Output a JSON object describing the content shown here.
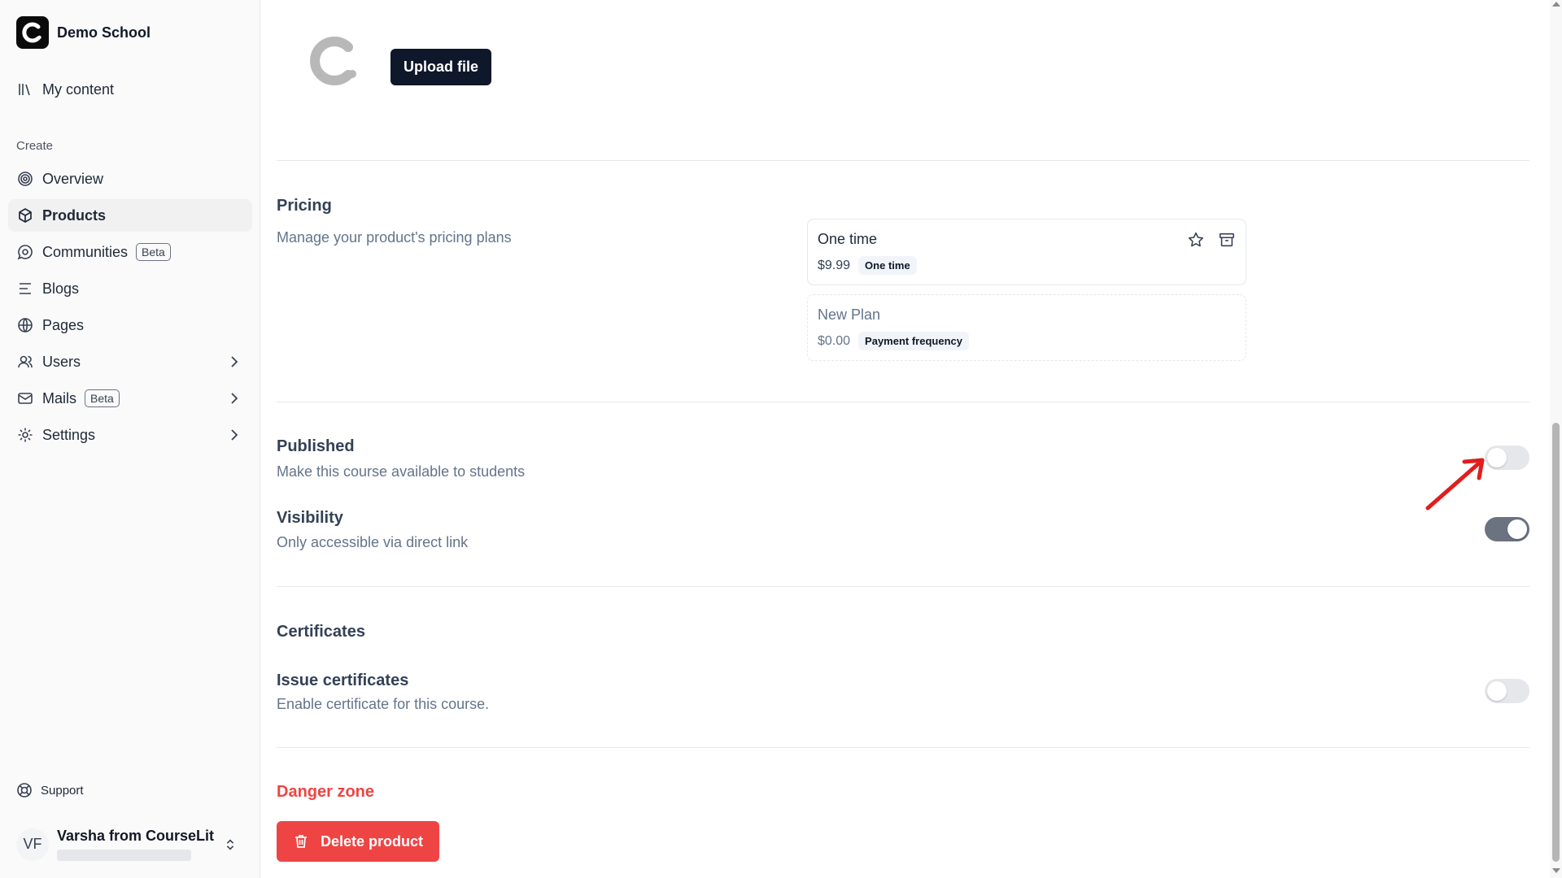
{
  "sidebar": {
    "brand": "Demo School",
    "my_content": "My content",
    "section_create": "Create",
    "items": [
      {
        "label": "Overview",
        "icon": "target-icon"
      },
      {
        "label": "Products",
        "icon": "box-icon",
        "active": true
      },
      {
        "label": "Communities",
        "icon": "chat-icon",
        "badge": "Beta"
      },
      {
        "label": "Blogs",
        "icon": "text-lines-icon"
      },
      {
        "label": "Pages",
        "icon": "globe-icon"
      },
      {
        "label": "Users",
        "icon": "users-icon"
      },
      {
        "label": "Mails",
        "icon": "mail-icon",
        "badge": "Beta"
      },
      {
        "label": "Settings",
        "icon": "gear-icon"
      }
    ],
    "support": "Support",
    "user": {
      "initials": "VF",
      "name": "Varsha from CourseLit"
    }
  },
  "main": {
    "upload_label": "Upload file",
    "pricing": {
      "title": "Pricing",
      "description": "Manage your product's pricing plans",
      "plans": [
        {
          "name": "One time",
          "price": "$9.99",
          "tag": "One time"
        },
        {
          "name": "New Plan",
          "price": "$0.00",
          "tag": "Payment frequency"
        }
      ]
    },
    "published": {
      "title": "Published",
      "description": "Make this course available to students",
      "enabled": false
    },
    "visibility": {
      "title": "Visibility",
      "description": "Only accessible via direct link",
      "enabled": true
    },
    "certificates": {
      "title": "Certificates",
      "issue_title": "Issue certificates",
      "issue_description": "Enable certificate for this course.",
      "enabled": false
    },
    "danger": {
      "title": "Danger zone",
      "delete_label": "Delete product"
    }
  },
  "colors": {
    "accent": "#0f172a",
    "danger": "#ef4444",
    "annotation": "#e11d1d"
  }
}
